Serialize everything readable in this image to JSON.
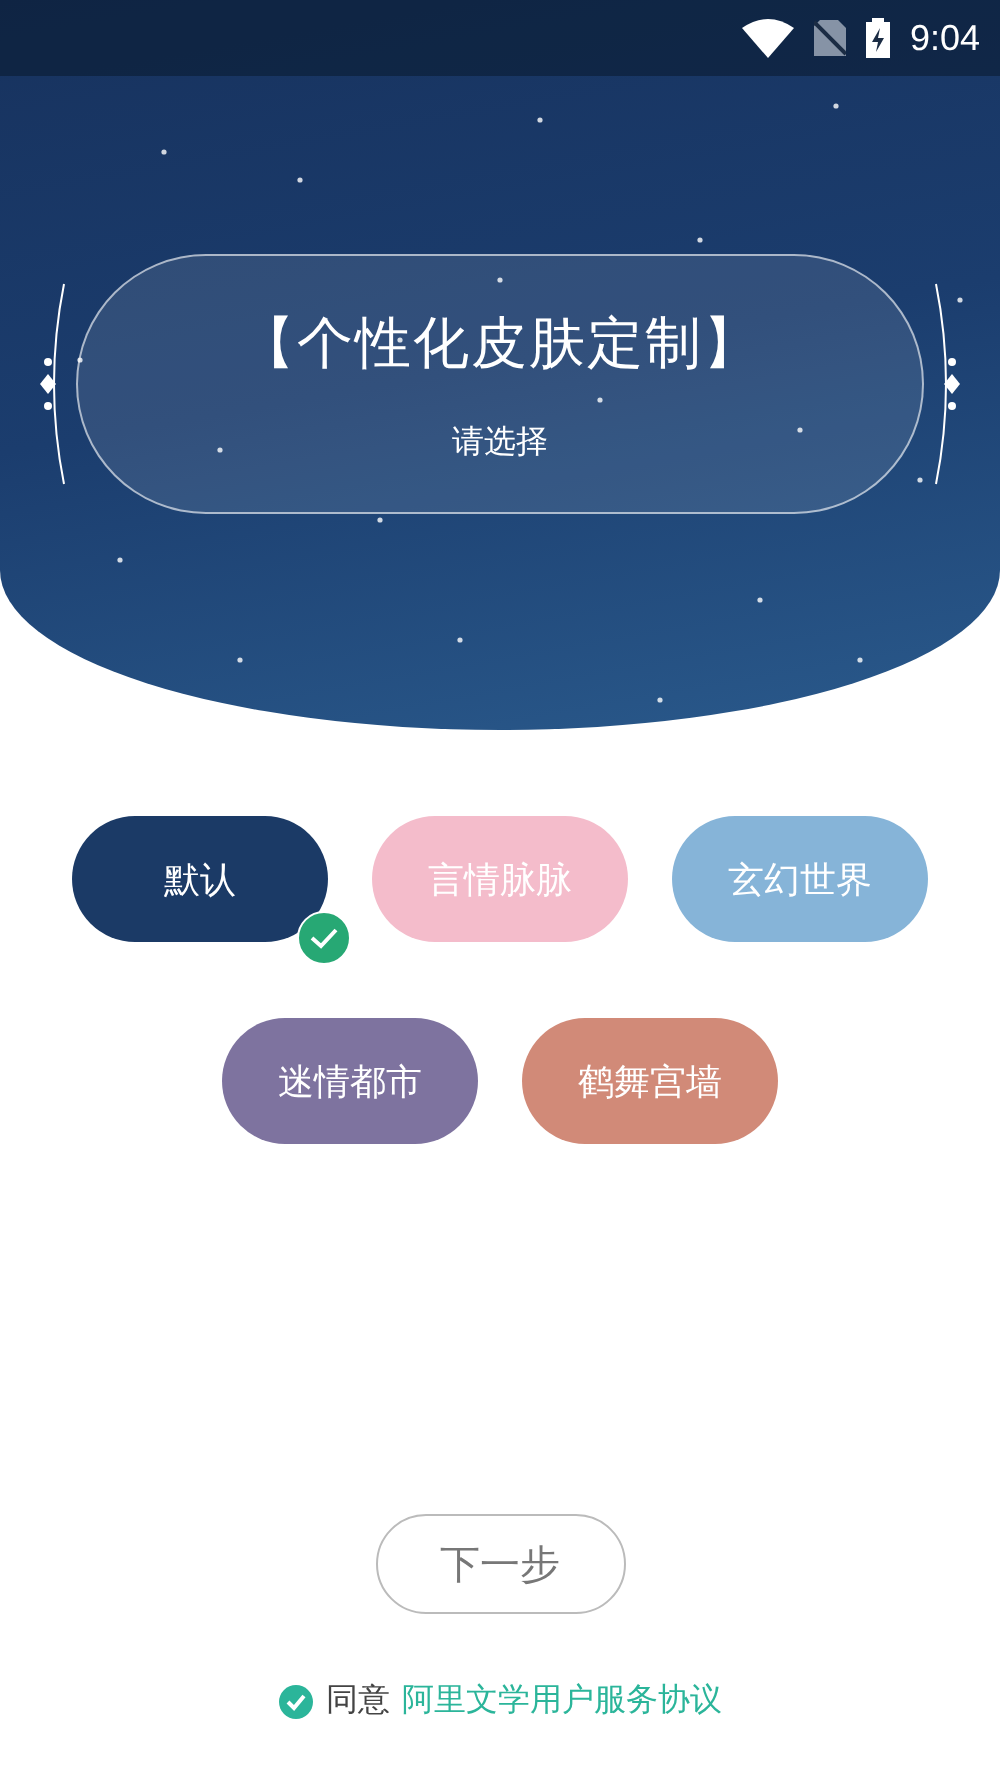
{
  "status_bar": {
    "time": "9:04"
  },
  "header": {
    "title": "【个性化皮肤定制】",
    "subtitle": "请选择"
  },
  "skins": [
    {
      "label": "默认",
      "selected": true,
      "color": "#1b3a66"
    },
    {
      "label": "言情脉脉",
      "selected": false,
      "color": "#f4bccb"
    },
    {
      "label": "玄幻世界",
      "selected": false,
      "color": "#86b4d8"
    },
    {
      "label": "迷情都市",
      "selected": false,
      "color": "#7e739f"
    },
    {
      "label": "鹤舞宫墙",
      "selected": false,
      "color": "#d18a78"
    }
  ],
  "next_button": {
    "label": "下一步"
  },
  "agreement": {
    "checked": true,
    "text": "同意",
    "link": "阿里文学用户服务协议"
  }
}
